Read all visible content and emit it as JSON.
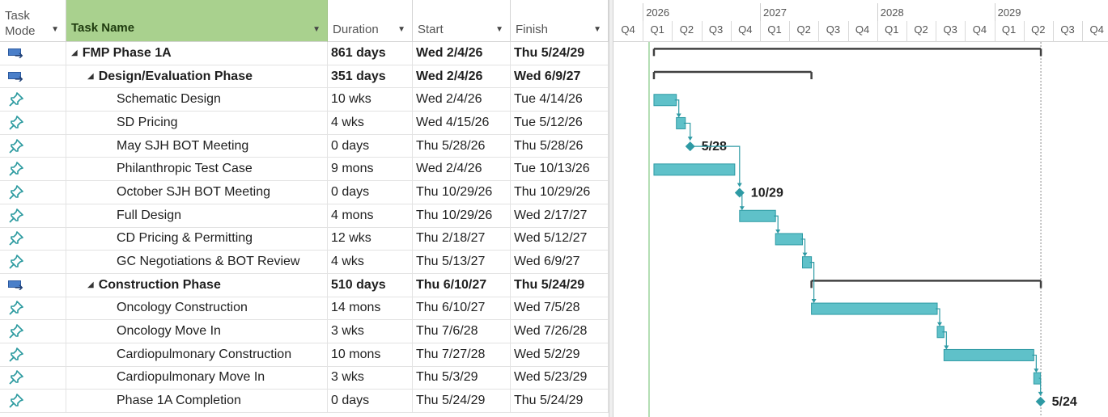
{
  "columns": {
    "task_mode": "Task Mode",
    "task_name": "Task Name",
    "duration": "Duration",
    "start": "Start",
    "finish": "Finish"
  },
  "timescale": {
    "years": [
      "2026",
      "2027",
      "2028",
      "2029"
    ],
    "quarters": [
      "Q4",
      "Q1",
      "Q2",
      "Q3",
      "Q4",
      "Q1",
      "Q2",
      "Q3",
      "Q4",
      "Q1",
      "Q2",
      "Q3",
      "Q4",
      "Q1",
      "Q2",
      "Q3",
      "Q4"
    ]
  },
  "colors": {
    "bar_fill": "#5fc1c9",
    "bar_edge": "#2e9aa4",
    "summary_line": "#404040",
    "link": "#2e9aa4",
    "milestone": "#2e9aa4",
    "header_highlight": "#a9d18e"
  },
  "tasks": [
    {
      "mode": "auto",
      "level": 0,
      "summary": true,
      "name": "FMP Phase 1A",
      "duration": "861 days",
      "start": "Wed 2/4/26",
      "finish": "Thu 5/24/29",
      "start_date": "2026-02-04",
      "finish_date": "2029-05-24"
    },
    {
      "mode": "auto",
      "level": 1,
      "summary": true,
      "name": "Design/Evaluation Phase",
      "duration": "351 days",
      "start": "Wed 2/4/26",
      "finish": "Wed 6/9/27",
      "start_date": "2026-02-04",
      "finish_date": "2027-06-09"
    },
    {
      "mode": "manual",
      "level": 2,
      "summary": false,
      "name": "Schematic Design",
      "duration": "10 wks",
      "start": "Wed 2/4/26",
      "finish": "Tue 4/14/26",
      "start_date": "2026-02-04",
      "finish_date": "2026-04-14"
    },
    {
      "mode": "manual",
      "level": 2,
      "summary": false,
      "name": "SD Pricing",
      "duration": "4 wks",
      "start": "Wed 4/15/26",
      "finish": "Tue 5/12/26",
      "start_date": "2026-04-15",
      "finish_date": "2026-05-12"
    },
    {
      "mode": "manual",
      "level": 2,
      "summary": false,
      "milestone": true,
      "name": "May SJH BOT Meeting",
      "duration": "0 days",
      "start": "Thu 5/28/26",
      "finish": "Thu 5/28/26",
      "start_date": "2026-05-28",
      "finish_date": "2026-05-28",
      "label": "5/28"
    },
    {
      "mode": "manual",
      "level": 2,
      "summary": false,
      "name": "Philanthropic Test Case",
      "duration": "9 mons",
      "start": "Wed 2/4/26",
      "finish": "Tue 10/13/26",
      "start_date": "2026-02-04",
      "finish_date": "2026-10-13"
    },
    {
      "mode": "manual",
      "level": 2,
      "summary": false,
      "milestone": true,
      "name": "October SJH BOT Meeting",
      "duration": "0 days",
      "start": "Thu 10/29/26",
      "finish": "Thu 10/29/26",
      "start_date": "2026-10-29",
      "finish_date": "2026-10-29",
      "label": "10/29"
    },
    {
      "mode": "manual",
      "level": 2,
      "summary": false,
      "name": "Full Design",
      "duration": "4 mons",
      "start": "Thu 10/29/26",
      "finish": "Wed 2/17/27",
      "start_date": "2026-10-29",
      "finish_date": "2027-02-17"
    },
    {
      "mode": "manual",
      "level": 2,
      "summary": false,
      "name": "CD Pricing & Permitting",
      "duration": "12 wks",
      "start": "Thu 2/18/27",
      "finish": "Wed 5/12/27",
      "start_date": "2027-02-18",
      "finish_date": "2027-05-12"
    },
    {
      "mode": "manual",
      "level": 2,
      "summary": false,
      "name": "GC Negotiations & BOT Review",
      "duration": "4 wks",
      "start": "Thu 5/13/27",
      "finish": "Wed 6/9/27",
      "start_date": "2027-05-13",
      "finish_date": "2027-06-09"
    },
    {
      "mode": "auto",
      "level": 1,
      "summary": true,
      "name": "Construction Phase",
      "duration": "510 days",
      "start": "Thu 6/10/27",
      "finish": "Thu 5/24/29",
      "start_date": "2027-06-10",
      "finish_date": "2029-05-24"
    },
    {
      "mode": "manual",
      "level": 2,
      "summary": false,
      "name": "Oncology Construction",
      "duration": "14 mons",
      "start": "Thu 6/10/27",
      "finish": "Wed 7/5/28",
      "start_date": "2027-06-10",
      "finish_date": "2028-07-05"
    },
    {
      "mode": "manual",
      "level": 2,
      "summary": false,
      "name": "Oncology Move In",
      "duration": "3 wks",
      "start": "Thu 7/6/28",
      "finish": "Wed 7/26/28",
      "start_date": "2028-07-06",
      "finish_date": "2028-07-26"
    },
    {
      "mode": "manual",
      "level": 2,
      "summary": false,
      "name": "Cardiopulmonary Construction",
      "duration": "10 mons",
      "start": "Thu 7/27/28",
      "finish": "Wed 5/2/29",
      "start_date": "2028-07-27",
      "finish_date": "2029-05-02"
    },
    {
      "mode": "manual",
      "level": 2,
      "summary": false,
      "name": "Cardiopulmonary Move In",
      "duration": "3 wks",
      "start": "Thu 5/3/29",
      "finish": "Wed 5/23/29",
      "start_date": "2029-05-03",
      "finish_date": "2029-05-23"
    },
    {
      "mode": "manual",
      "level": 2,
      "summary": false,
      "milestone": true,
      "name": "Phase 1A Completion",
      "duration": "0 days",
      "start": "Thu 5/24/29",
      "finish": "Thu 5/24/29",
      "start_date": "2029-05-24",
      "finish_date": "2029-05-24",
      "label": "5/24"
    }
  ]
}
